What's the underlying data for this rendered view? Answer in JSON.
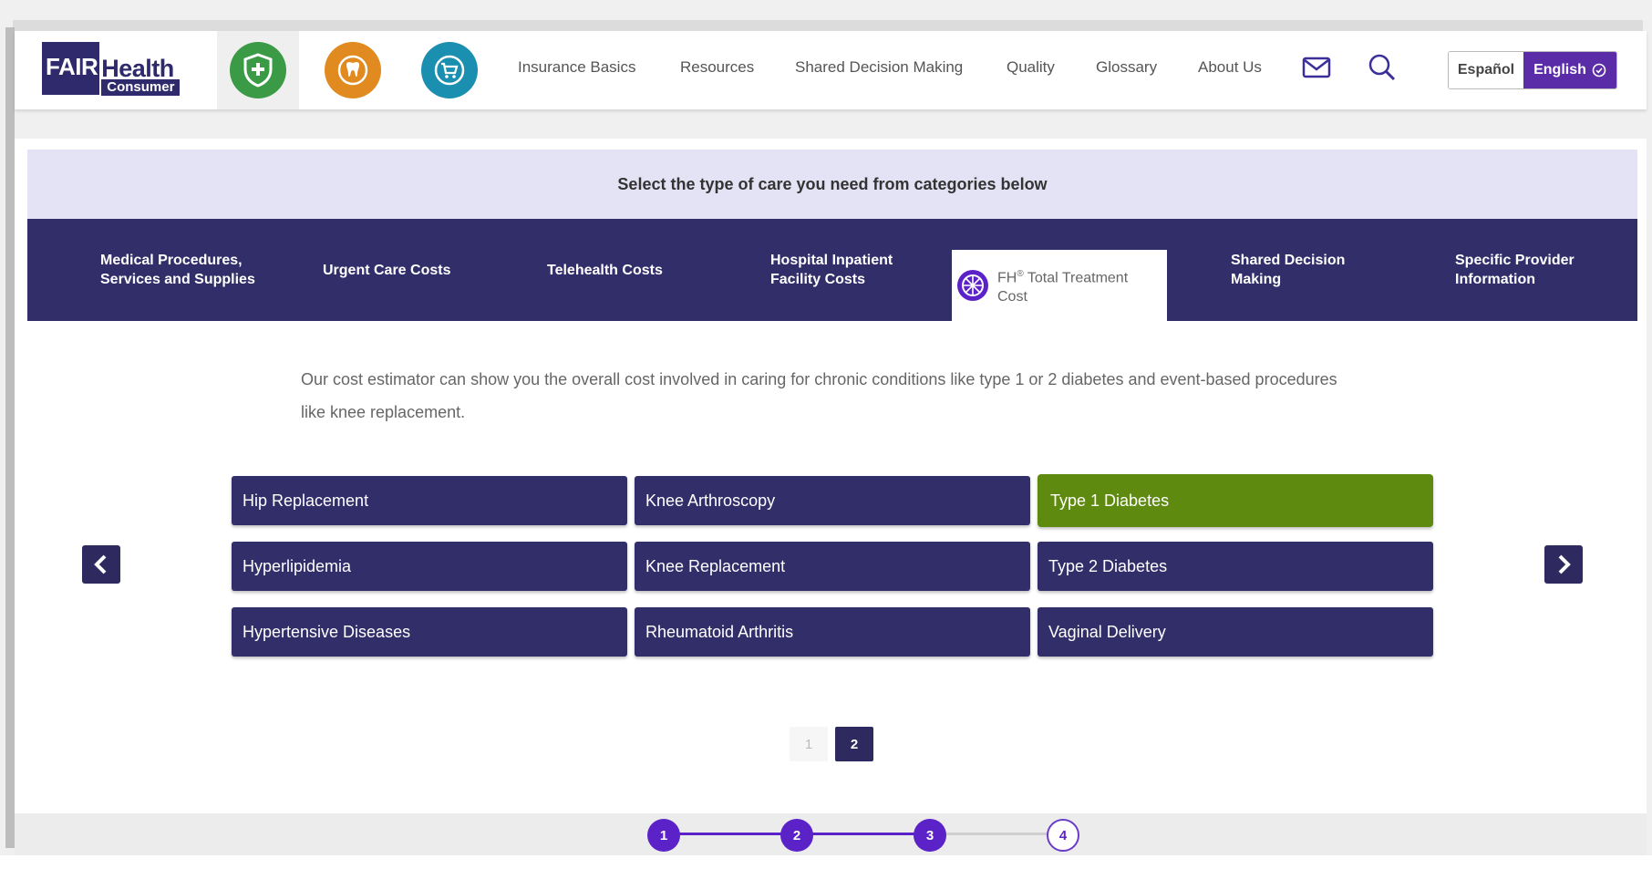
{
  "logo": {
    "fair": "FAIR",
    "health": "Health",
    "consumer": "Consumer"
  },
  "apps": [
    {
      "icon": "medical-shield-icon",
      "color": "#3a9a46"
    },
    {
      "icon": "dental-tooth-icon",
      "color": "#e08a20"
    },
    {
      "icon": "shopping-cart-icon",
      "color": "#1a8fb0"
    }
  ],
  "nav": [
    "Insurance Basics",
    "Resources",
    "Shared Decision Making",
    "Quality",
    "Glossary",
    "About Us"
  ],
  "language": {
    "es": "Español",
    "en": "English"
  },
  "banner": "Select the type of care you need from categories below",
  "tabs": [
    {
      "line1": "Medical Procedures,",
      "line2": "Services and Supplies"
    },
    {
      "line1": "Urgent Care Costs",
      "line2": ""
    },
    {
      "line1": "Telehealth Costs",
      "line2": ""
    },
    {
      "line1": "Hospital Inpatient",
      "line2": "Facility Costs"
    },
    {
      "line1": "FH",
      "sup": "®",
      "line1b": " Total Treatment",
      "line2": "Cost"
    },
    {
      "line1": "Shared Decision",
      "line2": "Making"
    },
    {
      "line1": "Specific Provider",
      "line2": "Information"
    }
  ],
  "description": "Our cost estimator can show you the overall cost involved in caring for chronic conditions like type 1 or 2 diabetes and event-based procedures like knee replacement.",
  "options": [
    "Hip Replacement",
    "Knee Arthroscopy",
    "Type 1 Diabetes",
    "Hyperlipidemia",
    "Knee Replacement",
    "Type 2 Diabetes",
    "Hypertensive Diseases",
    "Rheumatoid Arthritis",
    "Vaginal Delivery"
  ],
  "selected_option": "Type 1 Diabetes",
  "pagination": {
    "page1": "1",
    "page2": "2",
    "current": 2
  },
  "steps": [
    "1",
    "2",
    "3",
    "4"
  ],
  "completed_steps": 3,
  "colors": {
    "brand": "#322e6a",
    "selected": "#5f8a10",
    "accent": "#5b22c8"
  }
}
